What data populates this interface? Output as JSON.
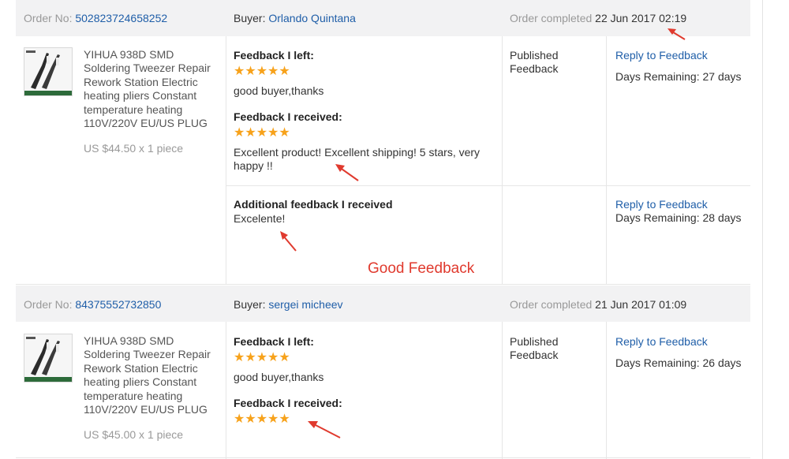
{
  "colors": {
    "accent_link": "#1f5ea8",
    "star": "#f7a21b",
    "annotation": "#e03a2e",
    "header_bg": "#f2f2f3"
  },
  "annotation_label": "Good Feedback",
  "orders": [
    {
      "order_no_label": "Order No:",
      "order_no": "502823724658252",
      "buyer_label": "Buyer:",
      "buyer": "Orlando Quintana",
      "completed_label": "Order completed",
      "completed_date": "22 Jun 2017 02:19",
      "product_title": "YIHUA 938D SMD Soldering Tweezer Repair Rework Station Electric heating pliers Constant temperature heating 110V/220V EU/US PLUG",
      "price": "US $44.50 x 1 piece",
      "feedback_left_title": "Feedback I left:",
      "feedback_left_stars": 5,
      "feedback_left_text": "good buyer,thanks",
      "feedback_received_title": "Feedback I received:",
      "feedback_received_stars": 5,
      "feedback_received_text": "Excellent product! Excellent shipping! 5 stars, very happy !!",
      "status": "Published Feedback",
      "reply_label": "Reply to Feedback",
      "days_remaining": "Days Remaining: 27 days",
      "additional_title": "Additional feedback I received",
      "additional_text": "Excelente!",
      "additional_reply_label": "Reply to Feedback",
      "additional_days_remaining": "Days Remaining: 28 days"
    },
    {
      "order_no_label": "Order No:",
      "order_no": "84375552732850",
      "buyer_label": "Buyer:",
      "buyer": "sergei micheev",
      "completed_label": "Order completed",
      "completed_date": "21 Jun 2017 01:09",
      "product_title": "YIHUA 938D SMD Soldering Tweezer Repair Rework Station Electric heating pliers Constant temperature heating 110V/220V EU/US PLUG",
      "price": "US $45.00 x 1 piece",
      "feedback_left_title": "Feedback I left:",
      "feedback_left_stars": 5,
      "feedback_left_text": "good buyer,thanks",
      "feedback_received_title": "Feedback I received:",
      "feedback_received_stars": 5,
      "status": "Published Feedback",
      "reply_label": "Reply to Feedback",
      "days_remaining": "Days Remaining: 26 days"
    }
  ]
}
